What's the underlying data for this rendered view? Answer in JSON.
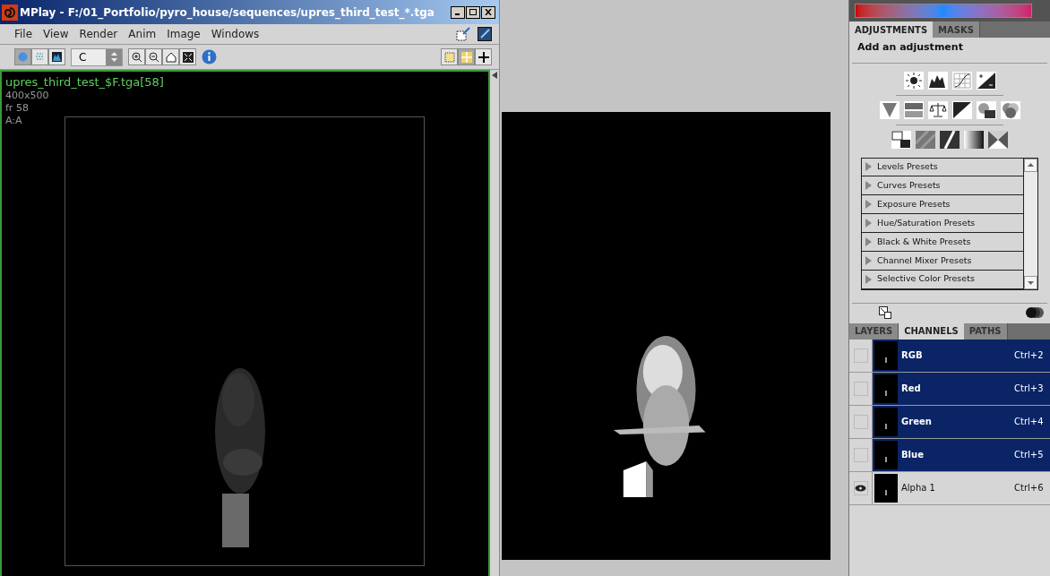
{
  "mplay": {
    "title": "MPlay - F:/01_Portfolio/pyro_house/sequences/upres_third_test_*.tga",
    "menu": [
      "File",
      "View",
      "Render",
      "Anim",
      "Image",
      "Windows"
    ],
    "channel_select": "C",
    "overlay": {
      "filename": "upres_third_test_$F.tga[58]",
      "resolution": "400x500",
      "frame": "fr 58",
      "aov": "A:A"
    }
  },
  "adjustments_panel": {
    "tabs": [
      {
        "label": "ADJUSTMENTS",
        "selected": true
      },
      {
        "label": "MASKS",
        "selected": false
      }
    ],
    "heading": "Add an adjustment",
    "presets": [
      "Levels Presets",
      "Curves Presets",
      "Exposure Presets",
      "Hue/Saturation Presets",
      "Black & White Presets",
      "Channel Mixer Presets",
      "Selective Color Presets"
    ]
  },
  "channels_panel": {
    "tabs": [
      {
        "label": "LAYERS",
        "selected": false
      },
      {
        "label": "CHANNELS",
        "selected": true
      },
      {
        "label": "PATHS",
        "selected": false
      }
    ],
    "channels": [
      {
        "name": "RGB",
        "shortcut": "Ctrl+2",
        "selected": true,
        "visible": false
      },
      {
        "name": "Red",
        "shortcut": "Ctrl+3",
        "selected": true,
        "visible": false
      },
      {
        "name": "Green",
        "shortcut": "Ctrl+4",
        "selected": true,
        "visible": false
      },
      {
        "name": "Blue",
        "shortcut": "Ctrl+5",
        "selected": true,
        "visible": false
      },
      {
        "name": "Alpha 1",
        "shortcut": "Ctrl+6",
        "selected": false,
        "visible": true
      }
    ]
  }
}
